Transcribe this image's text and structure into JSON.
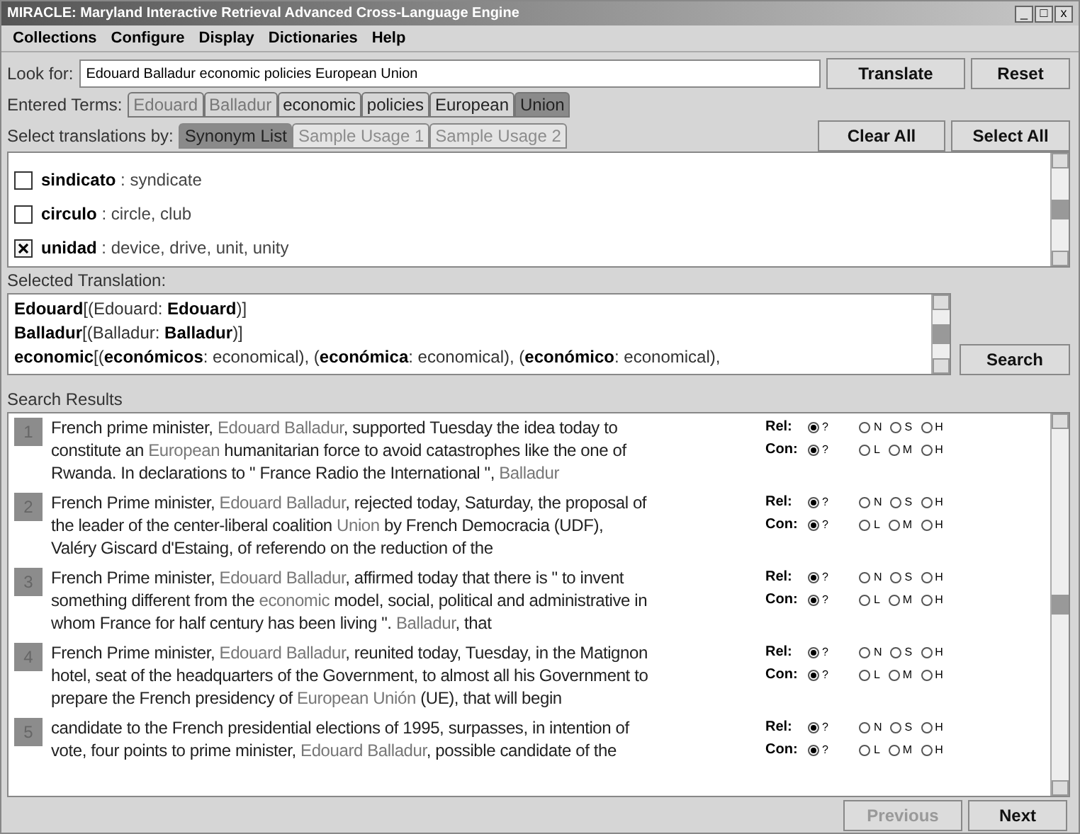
{
  "window": {
    "title": "MIRACLE: Maryland Interactive Retrieval Advanced Cross-Language Engine",
    "controls": [
      "_",
      "□",
      "x"
    ]
  },
  "menu": [
    "Collections",
    "Configure",
    "Display",
    "Dictionaries",
    "Help"
  ],
  "look_for": {
    "label": "Look for:",
    "value": "Edouard Balladur economic policies European Union"
  },
  "buttons": {
    "translate": "Translate",
    "reset": "Reset",
    "clear_all": "Clear All",
    "select_all": "Select All",
    "search": "Search"
  },
  "entered_terms": {
    "label": "Entered Terms:",
    "terms": [
      {
        "text": "Edouard",
        "dimmed": true,
        "selected": false
      },
      {
        "text": "Balladur",
        "dimmed": true,
        "selected": false
      },
      {
        "text": "economic",
        "dimmed": false,
        "selected": false
      },
      {
        "text": "policies",
        "dimmed": false,
        "selected": false
      },
      {
        "text": "European",
        "dimmed": false,
        "selected": false
      },
      {
        "text": "Union",
        "dimmed": false,
        "selected": true
      }
    ]
  },
  "translation_tabs": {
    "label": "Select translations by:",
    "tabs": [
      {
        "label": "Synonym List",
        "selected": true,
        "disabled": false
      },
      {
        "label": "Sample Usage 1",
        "selected": false,
        "disabled": true
      },
      {
        "label": "Sample Usage 2",
        "selected": false,
        "disabled": true
      }
    ]
  },
  "synonyms": [
    {
      "word": "sindicato",
      "meaning": " : syndicate",
      "checked": false
    },
    {
      "word": "circulo",
      "meaning": " : circle, club",
      "checked": false
    },
    {
      "word": "unidad",
      "meaning": " : device, drive, unit, unity",
      "checked": true
    }
  ],
  "selected_translation": {
    "label": "Selected Translation:",
    "lines": [
      "**Edouard**[(Edouard: **Edouard**)]",
      "**Balladur**[(Balladur: **Balladur**)]",
      "**economic**[(**económicos**: economical), (**económica**: economical), (**económico**: economical),"
    ]
  },
  "search_results": {
    "label": "Search Results",
    "results": [
      {
        "number": "1",
        "rel_label": "Rel:",
        "con_label": "Con:",
        "lines": [
          [
            {
              "text": "French prime minister, ",
              "highlight": false
            },
            {
              "text": "Edouard Balladur",
              "highlight": true
            },
            {
              "text": ", supported Tuesday the idea today to",
              "highlight": false
            }
          ],
          [
            {
              "text": "constitute an ",
              "highlight": false
            },
            {
              "text": "European",
              "highlight": true
            },
            {
              "text": " humanitarian force to avoid catastrophes like the one of",
              "highlight": false
            }
          ],
          [
            {
              "text": "Rwanda. In declarations to \" France Radio the International \", ",
              "highlight": false
            },
            {
              "text": "Balladur",
              "highlight": true
            }
          ]
        ],
        "rel": [
          {
            "label": "?",
            "selected": true
          },
          {
            "label": "N",
            "selected": false
          },
          {
            "label": "S",
            "selected": false
          },
          {
            "label": "H",
            "selected": false
          }
        ],
        "con": [
          {
            "label": "?",
            "selected": true
          },
          {
            "label": "L",
            "selected": false
          },
          {
            "label": "M",
            "selected": false
          },
          {
            "label": "H",
            "selected": false
          }
        ]
      },
      {
        "number": "2",
        "rel_label": "Rel:",
        "con_label": "Con:",
        "lines": [
          [
            {
              "text": "French Prime minister, ",
              "highlight": false
            },
            {
              "text": "Edouard Balladur",
              "highlight": true
            },
            {
              "text": ", rejected today, Saturday, the proposal of",
              "highlight": false
            }
          ],
          [
            {
              "text": "the leader of the center-liberal coalition ",
              "highlight": false
            },
            {
              "text": "Union",
              "highlight": true
            },
            {
              "text": " by French Democracia (UDF),",
              "highlight": false
            }
          ],
          [
            {
              "text": "Valéry Giscard d'Estaing, of referendo on the reduction of the",
              "highlight": false
            }
          ]
        ],
        "rel": [
          {
            "label": "?",
            "selected": true
          },
          {
            "label": "N",
            "selected": false
          },
          {
            "label": "S",
            "selected": false
          },
          {
            "label": "H",
            "selected": false
          }
        ],
        "con": [
          {
            "label": "?",
            "selected": true
          },
          {
            "label": "L",
            "selected": false
          },
          {
            "label": "M",
            "selected": false
          },
          {
            "label": "H",
            "selected": false
          }
        ]
      },
      {
        "number": "3",
        "rel_label": "Rel:",
        "con_label": "Con:",
        "lines": [
          [
            {
              "text": "French Prime minister, ",
              "highlight": false
            },
            {
              "text": "Edouard Balladur",
              "highlight": true
            },
            {
              "text": ", affirmed today that there is \" to invent",
              "highlight": false
            }
          ],
          [
            {
              "text": "something different from the ",
              "highlight": false
            },
            {
              "text": "economic",
              "highlight": true
            },
            {
              "text": " model, social, political and administrative in",
              "highlight": false
            }
          ],
          [
            {
              "text": "whom France for half century has been living \". ",
              "highlight": false
            },
            {
              "text": "Balladur",
              "highlight": true
            },
            {
              "text": ", that",
              "highlight": false
            }
          ]
        ],
        "rel": [
          {
            "label": "?",
            "selected": true
          },
          {
            "label": "N",
            "selected": false
          },
          {
            "label": "S",
            "selected": false
          },
          {
            "label": "H",
            "selected": false
          }
        ],
        "con": [
          {
            "label": "?",
            "selected": true
          },
          {
            "label": "L",
            "selected": false
          },
          {
            "label": "M",
            "selected": false
          },
          {
            "label": "H",
            "selected": false
          }
        ]
      },
      {
        "number": "4",
        "rel_label": "Rel:",
        "con_label": "Con:",
        "lines": [
          [
            {
              "text": "French Prime minister, ",
              "highlight": false
            },
            {
              "text": "Edouard Balladur",
              "highlight": true
            },
            {
              "text": ", reunited today, Tuesday, in the Matignon",
              "highlight": false
            }
          ],
          [
            {
              "text": "hotel, seat of the headquarters of the Government, to almost all his Government to",
              "highlight": false
            }
          ],
          [
            {
              "text": "prepare the French presidency of ",
              "highlight": false
            },
            {
              "text": "European Unión",
              "highlight": true
            },
            {
              "text": " (UE), that will begin",
              "highlight": false
            }
          ]
        ],
        "rel": [
          {
            "label": "?",
            "selected": true
          },
          {
            "label": "N",
            "selected": false
          },
          {
            "label": "S",
            "selected": false
          },
          {
            "label": "H",
            "selected": false
          }
        ],
        "con": [
          {
            "label": "?",
            "selected": true
          },
          {
            "label": "L",
            "selected": false
          },
          {
            "label": "M",
            "selected": false
          },
          {
            "label": "H",
            "selected": false
          }
        ]
      },
      {
        "number": "5",
        "rel_label": "Rel:",
        "con_label": "Con:",
        "lines": [
          [
            {
              "text": "candidate to the French presidential elections of 1995, surpasses, in intention of",
              "highlight": false
            }
          ],
          [
            {
              "text": "vote, four points to prime minister, ",
              "highlight": false
            },
            {
              "text": "Edouard Balladur",
              "highlight": true
            },
            {
              "text": ", possible candidate of the",
              "highlight": false
            }
          ]
        ],
        "rel": [
          {
            "label": "?",
            "selected": true
          },
          {
            "label": "N",
            "selected": false
          },
          {
            "label": "S",
            "selected": false
          },
          {
            "label": "H",
            "selected": false
          }
        ],
        "con": [
          {
            "label": "?",
            "selected": true
          },
          {
            "label": "L",
            "selected": false
          },
          {
            "label": "M",
            "selected": false
          },
          {
            "label": "H",
            "selected": false
          }
        ]
      }
    ]
  },
  "pager": {
    "previous": {
      "label": "Previous",
      "disabled": true
    },
    "next": {
      "label": "Next",
      "disabled": false
    }
  }
}
